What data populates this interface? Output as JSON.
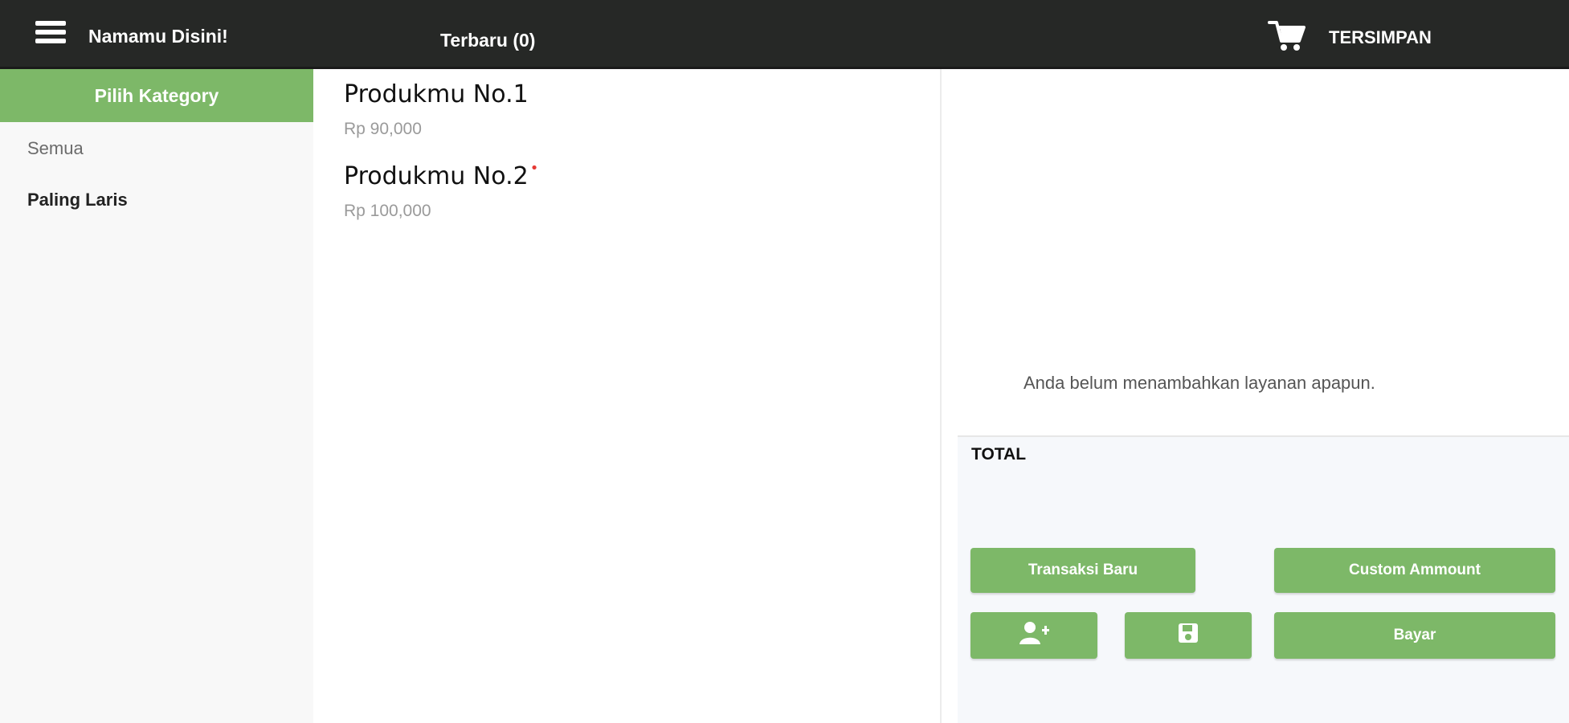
{
  "header": {
    "app_title": "Namamu Disini!",
    "latest_tab": "Terbaru (0)",
    "saved_label": "TERSIMPAN",
    "menu_icon": "hamburger-menu-icon",
    "cart_icon": "shopping-cart-icon"
  },
  "sidebar": {
    "header": "Pilih Kategory",
    "items": [
      {
        "label": "Semua"
      },
      {
        "label": "Paling Laris"
      }
    ]
  },
  "products": [
    {
      "name": "Produkmu No.1",
      "price": "Rp 90,000"
    },
    {
      "name": "Produkmu No.2",
      "price": "Rp 100,000",
      "marker": "•"
    }
  ],
  "cart": {
    "empty_message": "Anda belum menambahkan layanan apapun.",
    "total_label": "TOTAL",
    "buttons": {
      "new_transaction": "Transaksi Baru",
      "custom_amount": "Custom Ammount",
      "pay": "Bayar",
      "add_user_icon": "add-user-icon",
      "save_icon": "save-icon"
    }
  },
  "colors": {
    "topbar": "#262826",
    "accent_green": "#7db868",
    "sidebar_bg": "#f8f8f8",
    "price_grey": "#9a9a9a",
    "new_marker": "#e53935"
  }
}
